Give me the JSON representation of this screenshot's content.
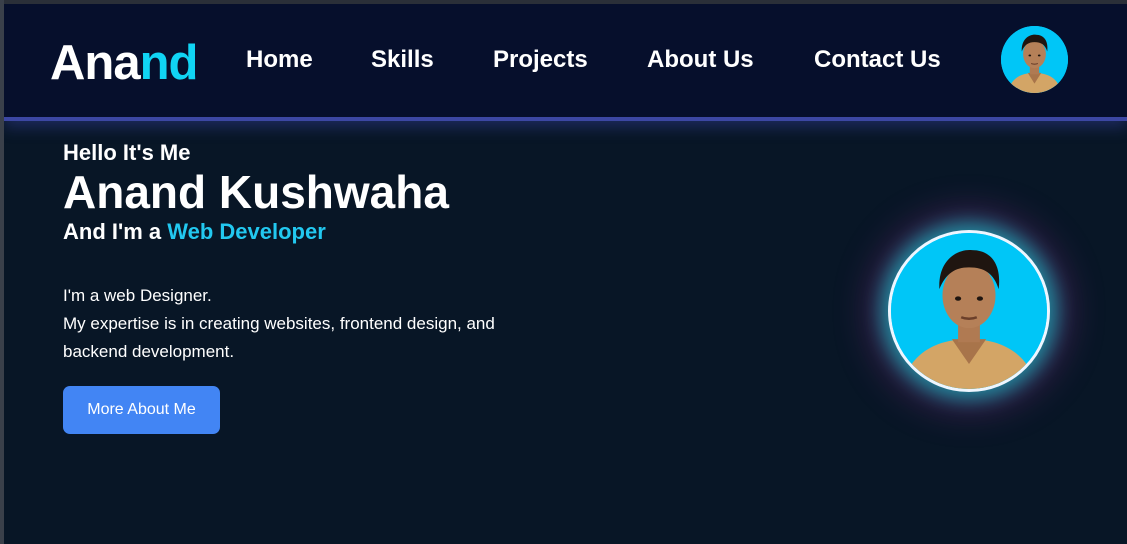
{
  "navbar": {
    "logo_main": "Ana",
    "logo_accent": "nd",
    "links": [
      "Home",
      "Skills",
      "Projects",
      "About Us",
      "Contact Us"
    ],
    "avatar_icon": "profile-photo-icon"
  },
  "hero": {
    "greeting": "Hello It's Me",
    "name": "Anand Kushwaha",
    "role_prefix": "And I'm a ",
    "role_highlight": "Web Developer",
    "desc_line1": "I'm a web Designer.",
    "desc_line2": "My expertise is in creating websites, frontend design, and backend development.",
    "button_label": "More About Me"
  },
  "colors": {
    "page_bg": "#081626",
    "navbar_bg": "#060f2c",
    "accent": "#10d4f4",
    "button": "#4285f4",
    "photo_bg": "#00c6f7"
  }
}
